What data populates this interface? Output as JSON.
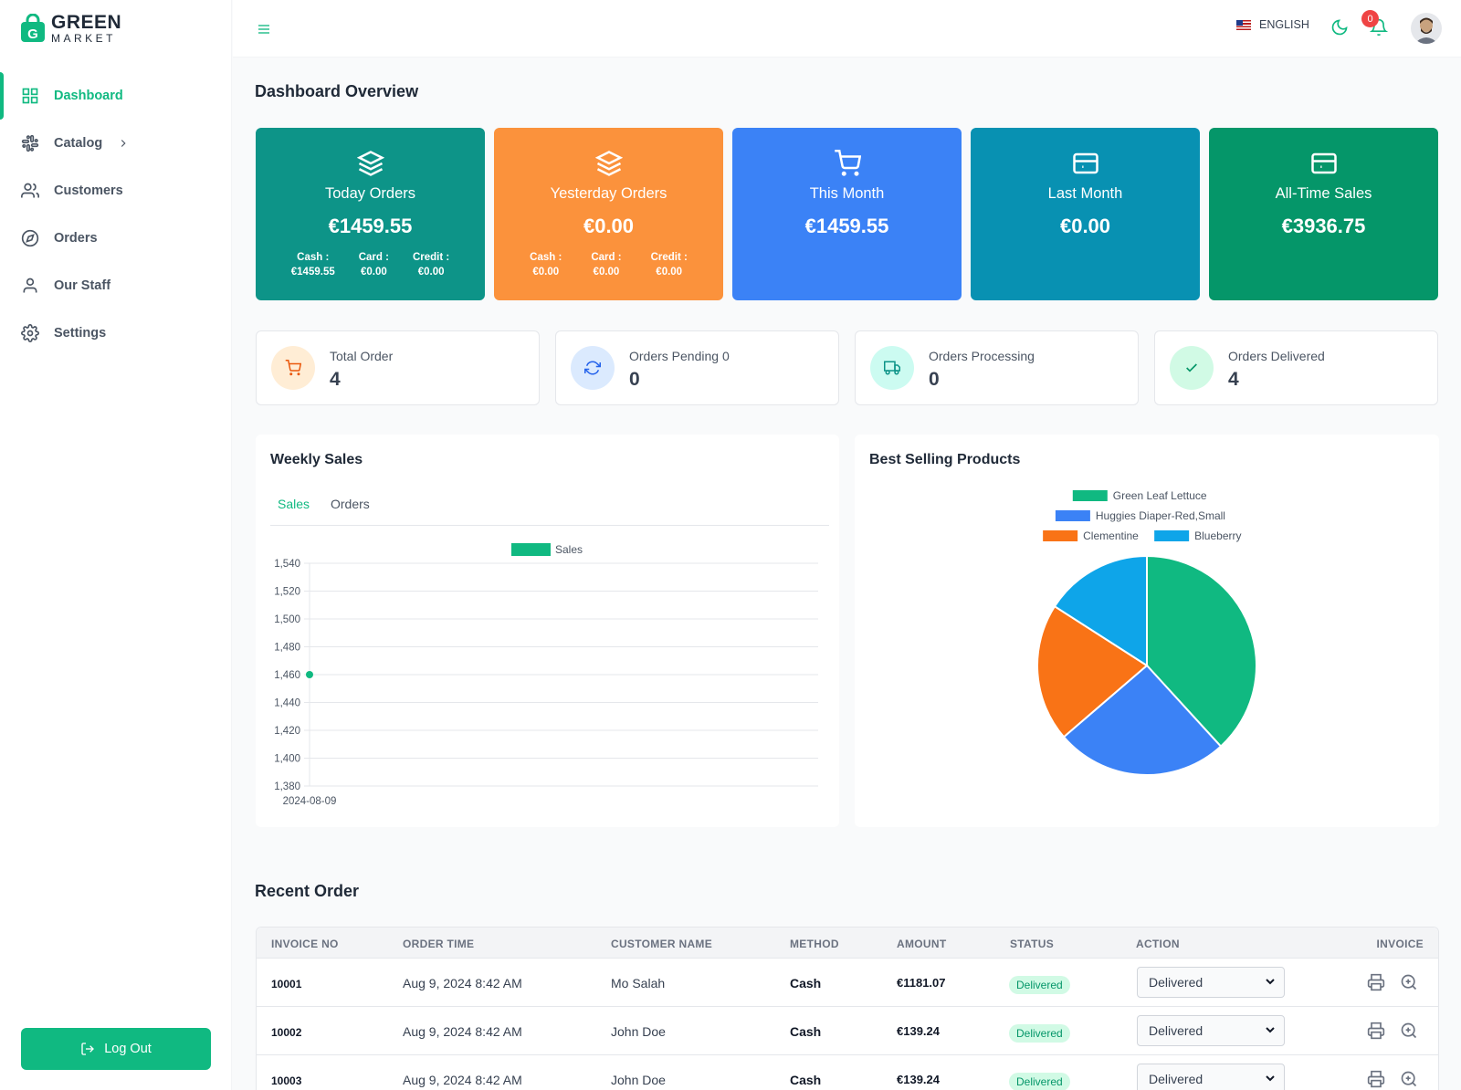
{
  "brand": {
    "line1": "GREEN",
    "line2": "MARKET"
  },
  "sidebar": {
    "items": [
      {
        "label": "Dashboard",
        "icon": "grid-icon"
      },
      {
        "label": "Catalog",
        "icon": "slack-icon"
      },
      {
        "label": "Customers",
        "icon": "users-icon"
      },
      {
        "label": "Orders",
        "icon": "compass-icon"
      },
      {
        "label": "Our Staff",
        "icon": "user-icon"
      },
      {
        "label": "Settings",
        "icon": "gear-icon"
      }
    ],
    "logout_label": "Log Out"
  },
  "header": {
    "language": "ENGLISH",
    "notification_count": "0"
  },
  "page_title": "Dashboard Overview",
  "summary_cards": [
    {
      "label": "Today Orders",
      "value": "€1459.55",
      "color": "#0d9488",
      "icon": "layers-icon",
      "breakdown": [
        {
          "k": "Cash :",
          "v": "€1459.55"
        },
        {
          "k": "Card :",
          "v": "€0.00"
        },
        {
          "k": "Credit :",
          "v": "€0.00"
        }
      ]
    },
    {
      "label": "Yesterday Orders",
      "value": "€0.00",
      "color": "#fb923c",
      "icon": "layers-icon",
      "breakdown": [
        {
          "k": "Cash :",
          "v": "€0.00"
        },
        {
          "k": "Card :",
          "v": "€0.00"
        },
        {
          "k": "Credit :",
          "v": "€0.00"
        }
      ]
    },
    {
      "label": "This Month",
      "value": "€1459.55",
      "color": "#3b82f6",
      "icon": "cart-icon"
    },
    {
      "label": "Last Month",
      "value": "€0.00",
      "color": "#0891b2",
      "icon": "credit-card-icon"
    },
    {
      "label": "All-Time Sales",
      "value": "€3936.75",
      "color": "#059669",
      "icon": "credit-card-icon"
    }
  ],
  "stat_cards": [
    {
      "label": "Total Order",
      "value": "4",
      "icon": "cart-icon",
      "bg": "#ffedd5",
      "fg": "#ea580c"
    },
    {
      "label": "Orders Pending 0",
      "value": "0",
      "icon": "refresh-icon",
      "bg": "#dbeafe",
      "fg": "#2563eb"
    },
    {
      "label": "Orders Processing",
      "value": "0",
      "icon": "truck-icon",
      "bg": "#ccfbf1",
      "fg": "#0d9488"
    },
    {
      "label": "Orders Delivered",
      "value": "4",
      "icon": "check-icon",
      "bg": "#d1fae5",
      "fg": "#059669"
    }
  ],
  "weekly_sales": {
    "title": "Weekly Sales",
    "tabs": [
      "Sales",
      "Orders"
    ],
    "active_tab": "Sales"
  },
  "best_selling": {
    "title": "Best Selling Products"
  },
  "chart_data": [
    {
      "type": "line",
      "title": "",
      "legend": [
        "Sales"
      ],
      "x": [
        "2024-08-09"
      ],
      "series": [
        {
          "name": "Sales",
          "values": [
            1460
          ],
          "color": "#10b981"
        }
      ],
      "ylim": [
        1380,
        1540
      ],
      "yticks": [
        "1,380",
        "1,400",
        "1,420",
        "1,440",
        "1,460",
        "1,480",
        "1,500",
        "1,520",
        "1,540"
      ],
      "grid": true,
      "legend_position": "top"
    },
    {
      "type": "pie",
      "title": "",
      "legend_position": "top",
      "slices": [
        {
          "label": "Green Leaf Lettuce",
          "value": 3,
          "color": "#10b981"
        },
        {
          "label": "Huggies Diaper-Red,Small",
          "value": 2,
          "color": "#3b82f6"
        },
        {
          "label": "Clementine",
          "value": 1.6,
          "color": "#f97316"
        },
        {
          "label": "Blueberry",
          "value": 1.25,
          "color": "#0ea5e9"
        }
      ]
    }
  ],
  "recent_orders": {
    "title": "Recent Order",
    "columns": [
      "INVOICE NO",
      "ORDER TIME",
      "CUSTOMER NAME",
      "METHOD",
      "AMOUNT",
      "STATUS",
      "ACTION",
      "INVOICE"
    ],
    "rows": [
      {
        "invoice": "10001",
        "time": "Aug 9, 2024 8:42 AM",
        "customer": "Mo Salah",
        "method": "Cash",
        "amount": "€1181.07",
        "status": "Delivered",
        "action": "Delivered"
      },
      {
        "invoice": "10002",
        "time": "Aug 9, 2024 8:42 AM",
        "customer": "John Doe",
        "method": "Cash",
        "amount": "€139.24",
        "status": "Delivered",
        "action": "Delivered"
      },
      {
        "invoice": "10003",
        "time": "Aug 9, 2024 8:42 AM",
        "customer": "John Doe",
        "method": "Cash",
        "amount": "€139.24",
        "status": "Delivered",
        "action": "Delivered"
      }
    ]
  }
}
